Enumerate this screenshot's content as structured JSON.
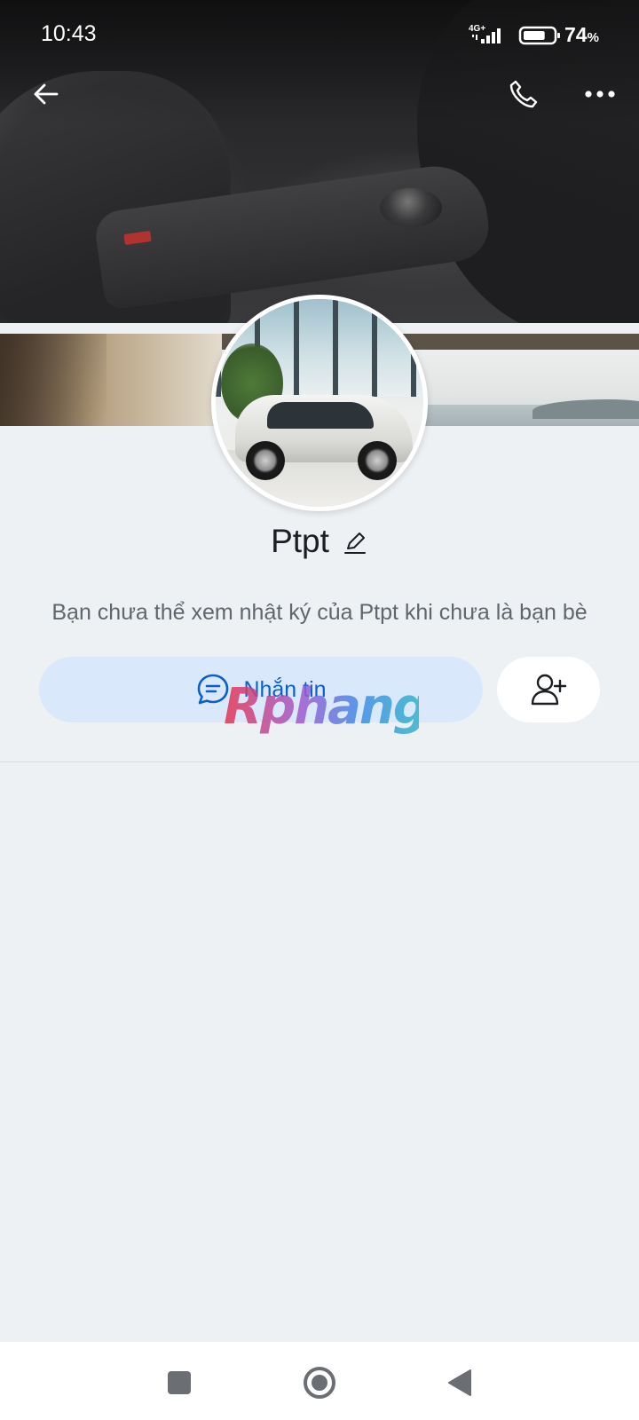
{
  "status_bar": {
    "time": "10:43",
    "network": "4G+",
    "battery_percent": "74",
    "battery_unit": "%",
    "battery_level": 0.74
  },
  "header": {
    "back_icon": "arrow-left-icon",
    "call_icon": "phone-icon",
    "more_icon": "more-horizontal-icon"
  },
  "profile": {
    "name": "Ptpt",
    "edit_icon": "pencil-icon",
    "info_text": "Bạn chưa thể xem nhật ký của Ptpt khi chưa là bạn bè"
  },
  "actions": {
    "message_label": "Nhắn tin",
    "message_icon": "chat-bubble-icon",
    "add_friend_icon": "add-user-icon"
  },
  "watermark": "Rphang",
  "nav": {
    "recent_icon": "square-icon",
    "home_icon": "circle-icon",
    "back_icon": "triangle-back-icon"
  },
  "colors": {
    "background": "#eef1f3",
    "accent": "#0a5fce",
    "message_button_bg": "#d9e9fb"
  }
}
